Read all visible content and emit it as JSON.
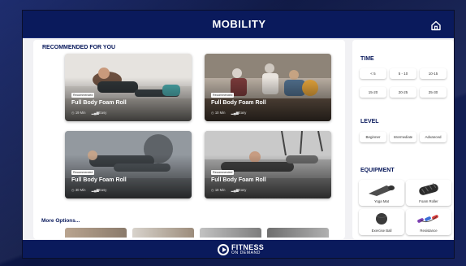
{
  "header": {
    "title": "MOBILITY",
    "home_icon": "home-icon"
  },
  "recommended": {
    "title": "RECOMMENDED FOR YOU",
    "cards": [
      {
        "badge": "Recommended",
        "title": "Full Body Foam Roll",
        "duration": "19 Min",
        "level": "Easy"
      },
      {
        "badge": "Recommended",
        "title": "Full Body Foam Roll",
        "duration": "10 Min",
        "level": "Easy"
      },
      {
        "badge": "Recommended",
        "title": "Full Body Foam Roll",
        "duration": "30 Min",
        "level": "Easy"
      },
      {
        "badge": "Recommended",
        "title": "Full Body Foam Roll",
        "duration": "18 Min",
        "level": "Easy"
      }
    ]
  },
  "more": {
    "title": "More Options..."
  },
  "filters": {
    "time": {
      "title": "TIME",
      "options": [
        "< 5",
        "5 - 10",
        "10-15",
        "15-20",
        "20-25",
        "25-30"
      ]
    },
    "level": {
      "title": "LEVEL",
      "options": [
        "Beginner",
        "Intermediate",
        "Advanced"
      ]
    },
    "equipment": {
      "title": "EQUIPMENT",
      "items": [
        "Yoga Mat",
        "Foam Roller",
        "Exercise Ball",
        "Resistance"
      ]
    }
  },
  "footer": {
    "brand": "FITNESS",
    "brand_sub": "ON DEMAND"
  },
  "colors": {
    "navy": "#0a1a5c",
    "panel": "#ffffff",
    "bg": "#f1f1f4"
  }
}
